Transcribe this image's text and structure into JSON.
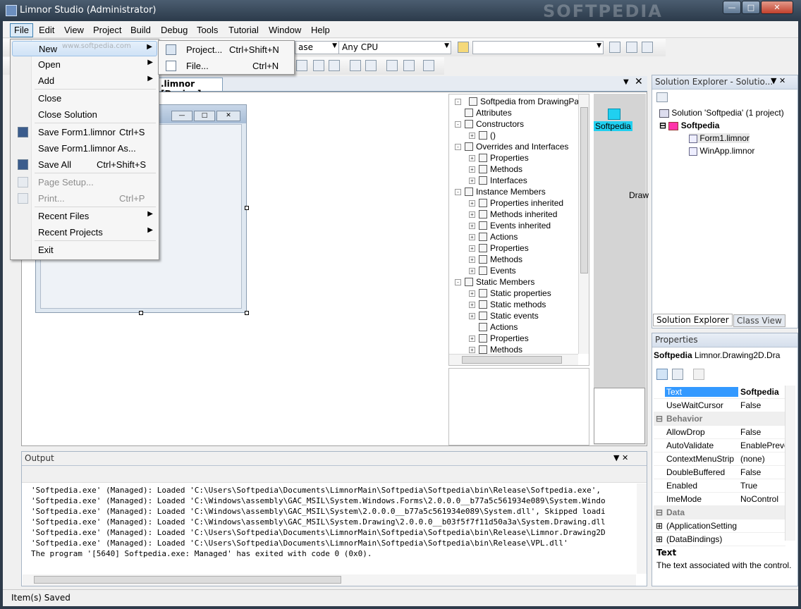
{
  "window": {
    "title": "Limnor Studio (Administrator)",
    "watermark": "SOFTPEDIA"
  },
  "menubar": [
    "File",
    "Edit",
    "View",
    "Project",
    "Build",
    "Debug",
    "Tools",
    "Tutorial",
    "Window",
    "Help"
  ],
  "toolbar": {
    "config_suffix": "ase",
    "platform": "Any CPU"
  },
  "file_menu": {
    "items": [
      {
        "label": "New",
        "shortcut": "",
        "submenu": true
      },
      {
        "label": "Open",
        "shortcut": "",
        "submenu": true
      },
      {
        "label": "Add",
        "shortcut": "",
        "submenu": true
      },
      {
        "label": "Close",
        "shortcut": ""
      },
      {
        "label": "Close Solution",
        "shortcut": ""
      },
      {
        "label": "Save Form1.limnor",
        "shortcut": "Ctrl+S"
      },
      {
        "label": "Save Form1.limnor As...",
        "shortcut": ""
      },
      {
        "label": "Save All",
        "shortcut": "Ctrl+Shift+S"
      },
      {
        "label": "Page Setup...",
        "shortcut": "",
        "disabled": true
      },
      {
        "label": "Print...",
        "shortcut": "Ctrl+P",
        "disabled": true
      },
      {
        "label": "Recent Files",
        "shortcut": "",
        "submenu": true
      },
      {
        "label": "Recent Projects",
        "shortcut": "",
        "submenu": true
      },
      {
        "label": "Exit",
        "shortcut": ""
      }
    ],
    "watermark": "www.softpedia.com"
  },
  "new_submenu": [
    {
      "label": "Project...",
      "shortcut": "Ctrl+Shift+N"
    },
    {
      "label": "File...",
      "shortcut": "Ctrl+N"
    }
  ],
  "designer": {
    "tab": ".limnor [Design]"
  },
  "object_tree": {
    "root": "Softpedia from DrawingPage",
    "nodes": [
      "Attributes",
      "Constructors",
      "()",
      "Overrides and Interfaces",
      "Properties",
      "Methods",
      "Interfaces",
      "Instance Members",
      "Properties inherited",
      "Methods inherited",
      "Events inherited",
      "Actions",
      "Properties",
      "Methods",
      "Events",
      "Static Members",
      "Static properties",
      "Static methods",
      "Static events",
      "Actions",
      "Properties",
      "Methods"
    ]
  },
  "canvas": {
    "selected_label": "Softpedia",
    "partial_label": "Draw"
  },
  "solution_explorer": {
    "title": "Solution Explorer - Solutio...",
    "solution": "Solution 'Softpedia' (1 project)",
    "project": "Softpedia",
    "files": [
      "Form1.limnor",
      "WinApp.limnor"
    ],
    "tabs": [
      "Solution Explorer",
      "Class View"
    ]
  },
  "properties": {
    "title": "Properties",
    "object_name": "Softpedia",
    "object_type": "Limnor.Drawing2D.Dra",
    "rows": [
      {
        "name": "Text",
        "value": "Softpedia",
        "selected": true
      },
      {
        "name": "UseWaitCursor",
        "value": "False"
      },
      {
        "category": "Behavior"
      },
      {
        "name": "AllowDrop",
        "value": "False"
      },
      {
        "name": "AutoValidate",
        "value": "EnablePreve"
      },
      {
        "name": "ContextMenuStrip",
        "value": "(none)"
      },
      {
        "name": "DoubleBuffered",
        "value": "False"
      },
      {
        "name": "Enabled",
        "value": "True"
      },
      {
        "name": "ImeMode",
        "value": "NoControl"
      },
      {
        "category": "Data"
      },
      {
        "name": "(ApplicationSetting",
        "value": "",
        "expandable": true
      },
      {
        "name": "(DataBindings)",
        "value": "",
        "expandable": true
      }
    ],
    "description_title": "Text",
    "description": "The text associated with the control."
  },
  "output": {
    "title": "Output",
    "lines": [
      "'Softpedia.exe' (Managed): Loaded 'C:\\Users\\Softpedia\\Documents\\LimnorMain\\Softpedia\\Softpedia\\bin\\Release\\Softpedia.exe',",
      "'Softpedia.exe' (Managed): Loaded 'C:\\Windows\\assembly\\GAC_MSIL\\System.Windows.Forms\\2.0.0.0__b77a5c561934e089\\System.Windo",
      "'Softpedia.exe' (Managed): Loaded 'C:\\Windows\\assembly\\GAC_MSIL\\System\\2.0.0.0__b77a5c561934e089\\System.dll', Skipped loadi",
      "'Softpedia.exe' (Managed): Loaded 'C:\\Windows\\assembly\\GAC_MSIL\\System.Drawing\\2.0.0.0__b03f5f7f11d50a3a\\System.Drawing.dll",
      "'Softpedia.exe' (Managed): Loaded 'C:\\Users\\Softpedia\\Documents\\LimnorMain\\Softpedia\\Softpedia\\bin\\Release\\Limnor.Drawing2D",
      "'Softpedia.exe' (Managed): Loaded 'C:\\Users\\Softpedia\\Documents\\LimnorMain\\Softpedia\\Softpedia\\bin\\Release\\VPL.dll'",
      "The program '[5640] Softpedia.exe: Managed' has exited with code 0 (0x0)."
    ]
  },
  "status": "Item(s) Saved"
}
